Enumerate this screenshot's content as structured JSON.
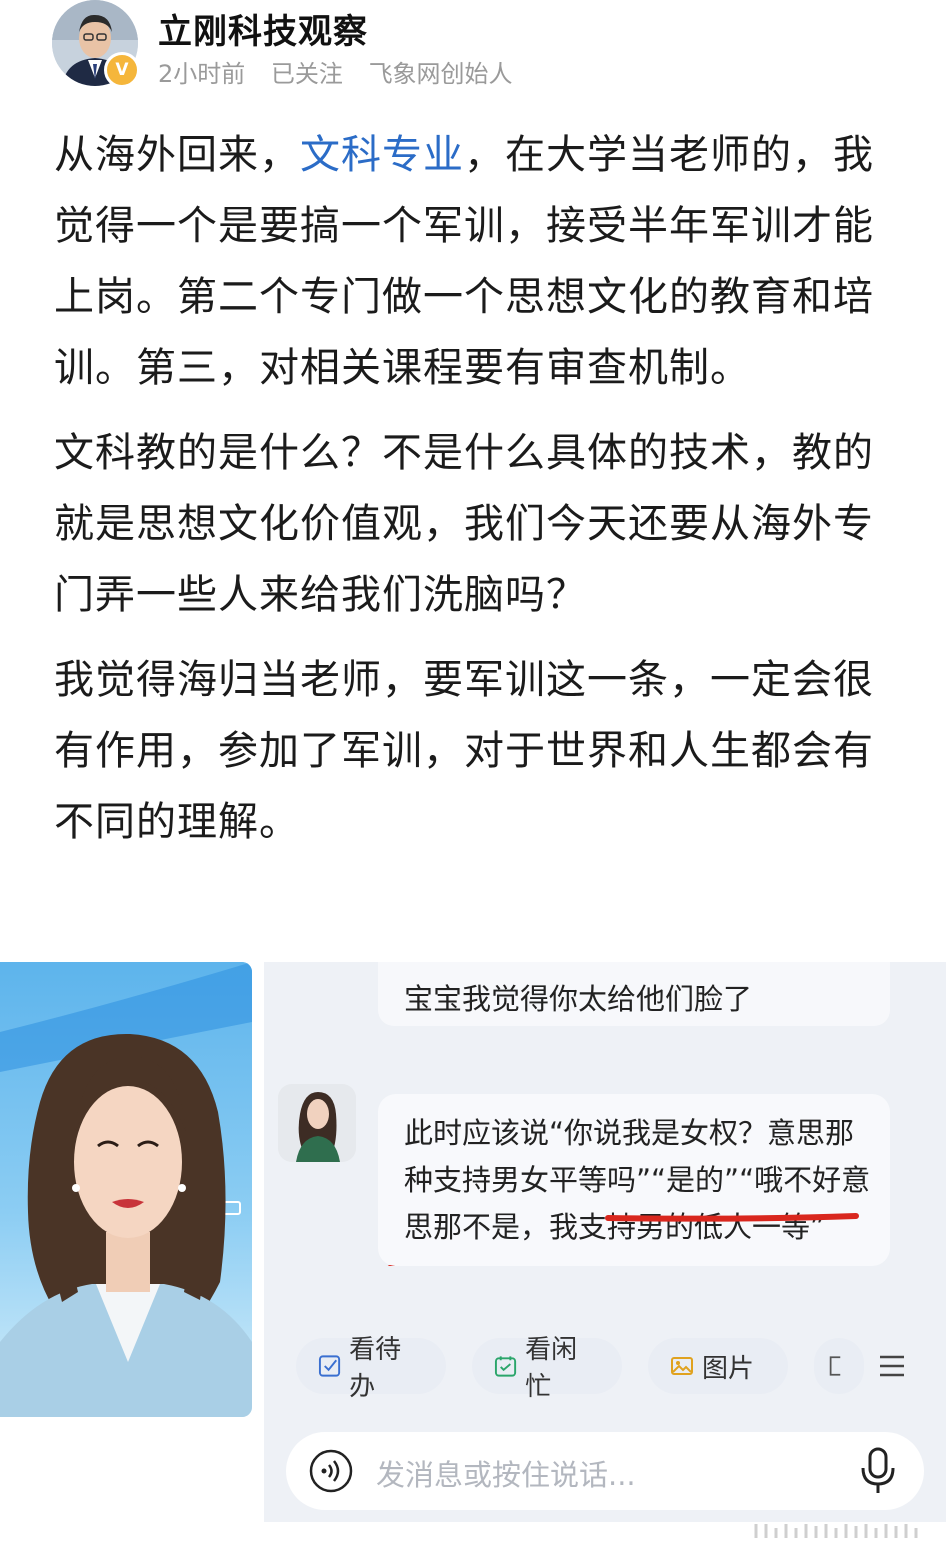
{
  "author": {
    "name": "立刚科技观察",
    "time": "2小时前",
    "follow_status": "已关注",
    "title": "飞象网创始人",
    "badge_icon": "verified-v-icon",
    "badge_text": "V"
  },
  "post": {
    "para1_prefix": "从海外回来，",
    "para1_link": "文科专业",
    "para1_rest": "，在大学当老师的，我觉得一个是要搞一个军训，接受半年军训才能上岗。第二个专门做一个思想文化的教育和培训。第三，对相关课程要有审查机制。",
    "para2": "文科教的是什么？不是什么具体的技术，教的就是思想文化价值观，我们今天还要从海外专门弄一些人来给我们洗脑吗？",
    "para3": "我觉得海归当老师，要军训这一条，一定会很有作用，参加了军训，对于世界和人生都会有不同的理解。",
    "link_color": "#2b6cc7"
  },
  "chat": {
    "user_message": "宝宝我觉得你太给他们脸了",
    "reply_plain": "此时应该说“你说我是女权？意思那种支持男女平等吗”“是的”“哦不好意思那不是，",
    "reply_underlined": "我支持男的低人一等",
    "reply_end": "”",
    "underline_color": "#d9271e",
    "toolbar": [
      {
        "label": "看待办",
        "icon": "checkbox-icon"
      },
      {
        "label": "看闲忙",
        "icon": "calendar-icon"
      },
      {
        "label": "图片",
        "icon": "image-icon"
      }
    ],
    "input_placeholder": "发消息或按住说话..."
  }
}
